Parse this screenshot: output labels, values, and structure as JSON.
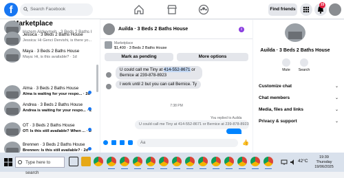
{
  "topbar": {
    "search_placeholder": "Search Facebook",
    "find_friends": "Find friends",
    "notif_count": "15"
  },
  "sidebar": {
    "title": "Marketplace",
    "conversations": [
      {
        "name": "Hazem Aldwymeh · 3 Beds 2 Baths House",
        "snippet": "",
        "unread": false
      },
      {
        "name": "Jessica · 3 Beds 2 Baths House",
        "snippet": "Jessica: Hi Genci Dervishi, is there yo... · 14h",
        "unread": false
      },
      {
        "name": "Maya · 3 Beds 2 Baths House",
        "snippet": "Maya: Hi, is this available? · 1d",
        "unread": false
      },
      {
        "name": "Alma · 3 Beds 2 Baths House",
        "snippet": "Alma is waiting for your respo... · 2d",
        "unread": true
      },
      {
        "name": "Andrea · 3 Beds 2 Baths House",
        "snippet": "Andrea is waiting for your respo... · 2d",
        "unread": true
      },
      {
        "name": "OT · 3 Beds 2 Baths House",
        "snippet": "OT: Is this still available? When ... · 2d",
        "unread": true
      },
      {
        "name": "Brennen · 3 Beds 2 Baths House",
        "snippet": "Brennen: Is this still available? · 2d",
        "unread": true
      }
    ]
  },
  "chat": {
    "title": "Auilda · 3 Beds 2 Baths House",
    "listing_label": "Marketplace",
    "listing_detail": "$1,400 · 3 Beds 2 Baths House",
    "mark_pending": "Mark as pending",
    "more_options": "More options",
    "msg1_a": "U could call me Tiny at ",
    "msg1_phone": "414-552-8671",
    "msg1_b": " or Bernice  at 239-878-8923",
    "msg2": "I work until 2 but you can call Bernice. Ty",
    "time": "7:38 PM",
    "replied_note": "You replied to Auilda",
    "quoted": "U could call me Tiny at 414-552-8671 or Bernice  at 239-878-8923",
    "composer_placeholder": "Aa"
  },
  "right_panel": {
    "title": "Auilda · 3 Beds 2 Baths House",
    "mute": "Mute",
    "search": "Search",
    "rows": [
      "Customize chat",
      "Chat members",
      "Media, files and links",
      "Privacy & support"
    ]
  },
  "taskbar": {
    "search_placeholder": "Type here to search",
    "temperature": "42°C",
    "time": "19:39",
    "day": "Thursday",
    "date": "19/06/2025"
  },
  "colors": {
    "brand": "#1877f2",
    "messenger_blue": "#0084ff",
    "unread_dot": "#1877f2",
    "notif_badge": "#e41e3f"
  }
}
